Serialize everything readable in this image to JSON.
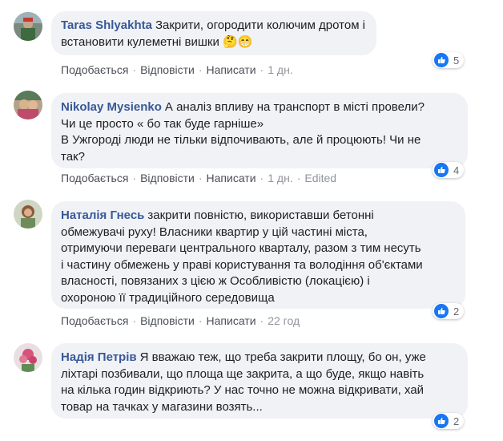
{
  "colors": {
    "bubble_bg": "#f0f2f5",
    "author": "#385898",
    "like_blue": "#1877f2",
    "action_text": "#4b4f56",
    "meta_text": "#90949c"
  },
  "actions": {
    "like": "Подобається",
    "reply": "Відповісти",
    "message": "Написати",
    "separator": "·"
  },
  "comments": [
    {
      "author": "Taras Shlyakhta",
      "text_1": "Закрити, огородити колючим дротом і",
      "text_2": "встановити кулеметні вишки",
      "emojis": "🤔😁",
      "time": "1 дн.",
      "edited": "",
      "reactions": "5",
      "reaction_icon": "like-icon"
    },
    {
      "author": "Nikolay Mysienko",
      "text_1": "А аналіз впливу на транспорт в місті провели?",
      "text_2": "Чи це просто « бо так буде гарніше»",
      "text_3": "В Ужгороді люди не тільки відпочивають, але й процюють! Чи не",
      "text_4": "так?",
      "time": "1 дн.",
      "edited": "Edited",
      "reactions": "4",
      "reaction_icon": "like-icon"
    },
    {
      "author": "Наталія Гнесь",
      "text_1": "закрити повністю, використавши бетонні",
      "text_2": "обмежувачі руху! Власники квартир у цій частині міста,",
      "text_3": "отримуючи переваги центрального кварталу, разом з тим несуть",
      "text_4": "і частину обмежень у праві користування та володіння об'єктами",
      "text_5": "власності, повязаних з цією ж Особливістю (локацією) і",
      "text_6": "охороною її традиційного середовища",
      "time": "22 год",
      "edited": "",
      "reactions": "2",
      "reaction_icon": "like-icon"
    },
    {
      "author": "Надія Петрів",
      "text_1": "Я вважаю теж, що треба закрити площу, бо он, уже",
      "text_2": "ліхтарі позбивали, що площа ще закрита, а що буде, якщо навіть",
      "text_3": "на кілька годин відкриють? У нас точно не можна відкривати, хай",
      "text_4": "товар на тачках у магазини возять...",
      "reactions": "2",
      "reaction_icon": "like-icon"
    }
  ]
}
